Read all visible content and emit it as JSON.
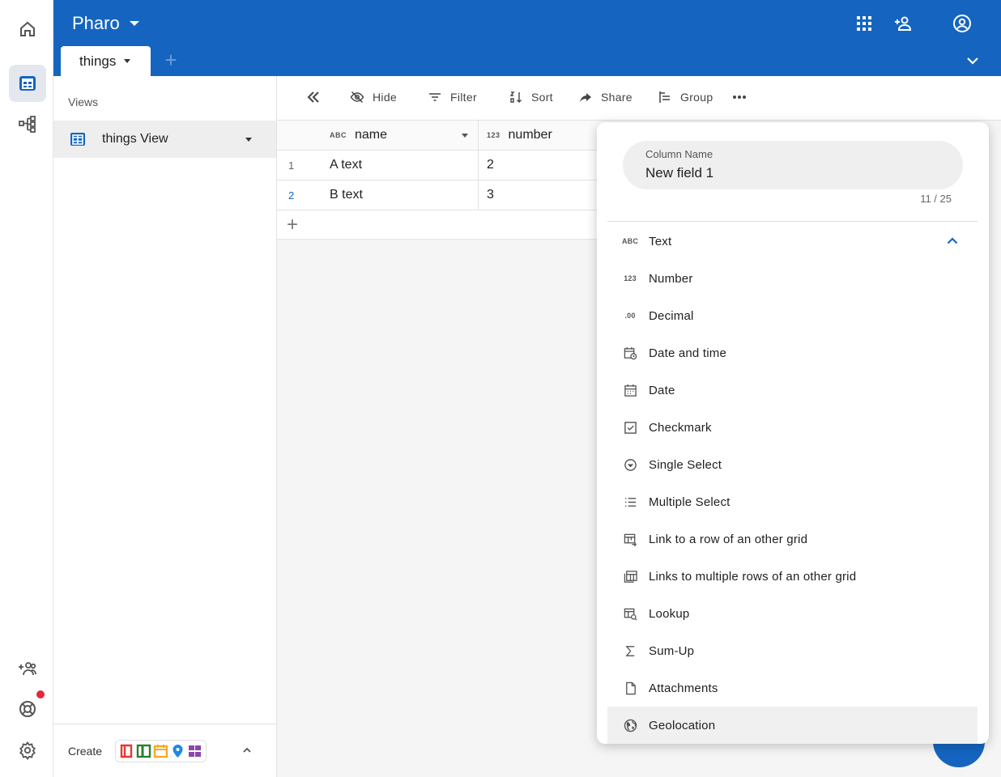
{
  "app": {
    "title": "Pharo"
  },
  "tabs": [
    {
      "label": "things"
    }
  ],
  "views": {
    "heading": "Views",
    "items": [
      {
        "label": "things View"
      }
    ],
    "create_label": "Create"
  },
  "toolbar": {
    "hide": "Hide",
    "filter": "Filter",
    "sort": "Sort",
    "share": "Share",
    "group": "Group"
  },
  "grid": {
    "columns": [
      {
        "type_tag": "ABC",
        "label": "name"
      },
      {
        "type_tag": "123",
        "label": "number"
      }
    ],
    "rows": [
      {
        "index": "1",
        "name": "A text",
        "number": "2"
      },
      {
        "index": "2",
        "name": "B text",
        "number": "3"
      }
    ]
  },
  "popup": {
    "field_label": "Column Name",
    "field_value": "New field 1",
    "counter": "11 / 25",
    "types": [
      {
        "icon": "abc",
        "label": "Text"
      },
      {
        "icon": "123",
        "label": "Number"
      },
      {
        "icon": ".00",
        "label": "Decimal"
      },
      {
        "icon": "calendar-clock",
        "label": "Date and time"
      },
      {
        "icon": "calendar",
        "label": "Date"
      },
      {
        "icon": "checkbox",
        "label": "Checkmark"
      },
      {
        "icon": "circle-chevron",
        "label": "Single Select"
      },
      {
        "icon": "list",
        "label": "Multiple Select"
      },
      {
        "icon": "table-link",
        "label": "Link to a row of an other grid"
      },
      {
        "icon": "table-multi",
        "label": "Links to multiple rows of an other grid"
      },
      {
        "icon": "table-search",
        "label": "Lookup"
      },
      {
        "icon": "sigma",
        "label": "Sum-Up"
      },
      {
        "icon": "file",
        "label": "Attachments"
      },
      {
        "icon": "globe",
        "label": "Geolocation"
      }
    ]
  },
  "colors": {
    "header": "#1565c0",
    "accent": "#1565c0",
    "notification": "#e8253b"
  }
}
